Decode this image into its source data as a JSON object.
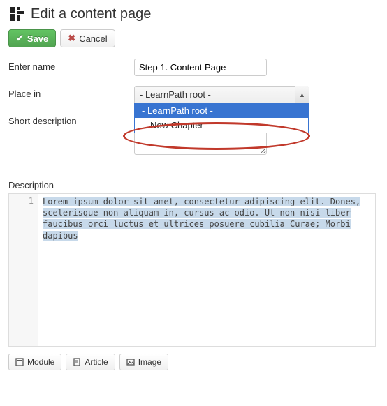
{
  "header": {
    "title": "Edit a content page"
  },
  "toolbar": {
    "save_label": "Save",
    "cancel_label": "Cancel"
  },
  "form": {
    "name_label": "Enter name",
    "name_value": "Step 1. Content Page",
    "place_label": "Place in",
    "place_selected": "- LearnPath root -",
    "place_options": [
      "- LearnPath root -",
      "New Chapter"
    ],
    "short_desc_label": "Short description",
    "short_desc_value": ""
  },
  "description": {
    "label": "Description",
    "gutter": "1",
    "text": "Lorem ipsum dolor sit amet, consectetur adipiscing elit. Dones, scelerisque non aliquam in, cursus ac odio. Ut non nisi liber  faucibus orci luctus et ultrices posuere cubilia Curae; Morbi dapibus "
  },
  "bottom": {
    "module_label": "Module",
    "article_label": "Article",
    "image_label": "Image"
  }
}
